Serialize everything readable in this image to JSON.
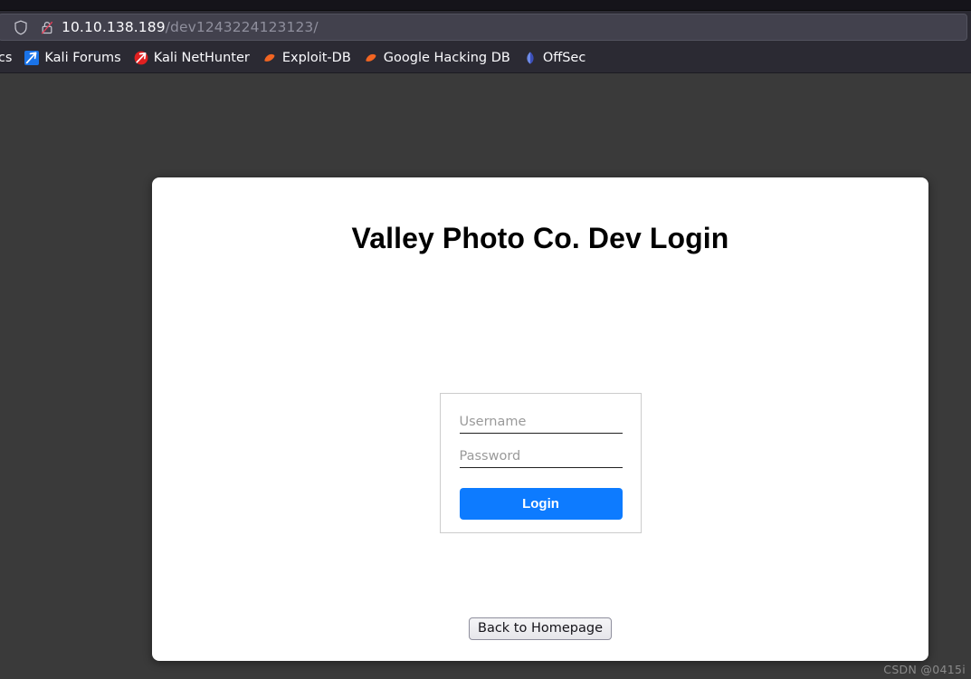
{
  "browser": {
    "urlbar": {
      "shield_icon": "shield-icon",
      "lock_icon": "lock-crossed-out-icon",
      "host": "10.10.138.189",
      "path": "/dev1243224123123/",
      "full_url": "10.10.138.189/dev1243224123123/"
    },
    "bookmarks": [
      {
        "label": "ocs",
        "icon": "kali-docs-icon",
        "icon_color": "#3b7dd8"
      },
      {
        "label": "Kali Forums",
        "icon": "kali-forums-icon",
        "icon_color": "#1a73e8"
      },
      {
        "label": "Kali NetHunter",
        "icon": "kali-nethunter-icon",
        "icon_color": "#e02020"
      },
      {
        "label": "Exploit-DB",
        "icon": "exploit-db-icon",
        "icon_color": "#f26522"
      },
      {
        "label": "Google Hacking DB",
        "icon": "google-hacking-db-icon",
        "icon_color": "#f26522"
      },
      {
        "label": "OffSec",
        "icon": "offsec-icon",
        "icon_color": "#4b6cd8"
      }
    ]
  },
  "page": {
    "background_color": "#3a3a3a",
    "card_color": "#ffffff",
    "title": "Valley Photo Co. Dev Login",
    "form": {
      "username_placeholder": "Username",
      "username_value": "",
      "password_placeholder": "Password",
      "password_value": "",
      "login_label": "Login",
      "login_color": "#0d7bff"
    },
    "back_label": "Back to Homepage"
  },
  "watermark": "CSDN @0415i"
}
